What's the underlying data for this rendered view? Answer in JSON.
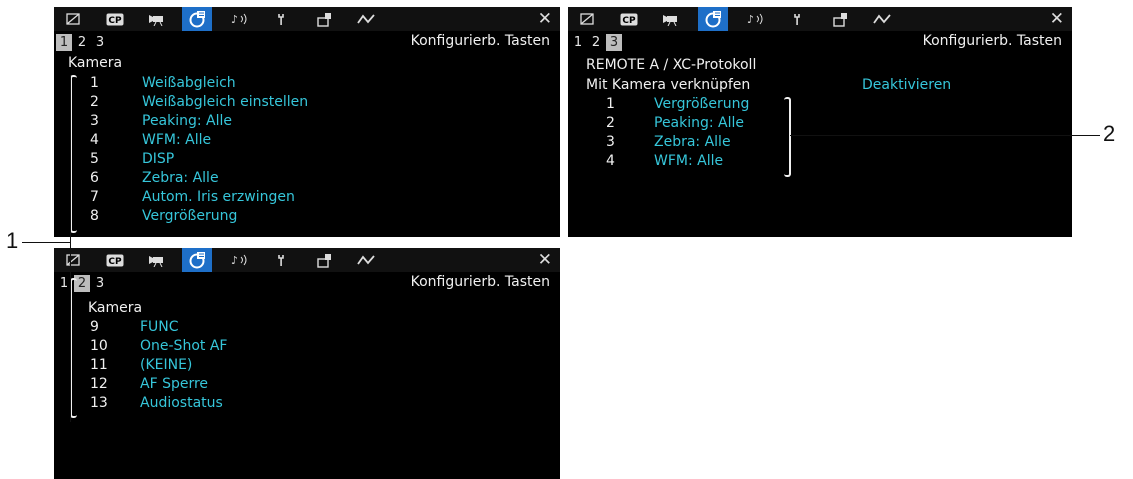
{
  "tabs": [
    {
      "icon": "picture-icon"
    },
    {
      "icon": "cp-icon",
      "label": "CP"
    },
    {
      "icon": "camera-icon"
    },
    {
      "icon": "custom-function-icon",
      "active": true
    },
    {
      "icon": "audio-icon"
    },
    {
      "icon": "wrench-icon"
    },
    {
      "icon": "assign-icon"
    },
    {
      "icon": "network-icon"
    }
  ],
  "close_label": "✕",
  "menu_title": "Konfigurierb. Tasten",
  "screen1": {
    "pages": [
      "1",
      "2",
      "3"
    ],
    "active_page": 0,
    "section": "Kamera",
    "items": [
      {
        "num": "1",
        "value": "Weißabgleich"
      },
      {
        "num": "2",
        "value": "Weißabgleich einstellen"
      },
      {
        "num": "3",
        "value": "Peaking: Alle"
      },
      {
        "num": "4",
        "value": "WFM: Alle"
      },
      {
        "num": "5",
        "value": "DISP"
      },
      {
        "num": "6",
        "value": "Zebra: Alle"
      },
      {
        "num": "7",
        "value": "Autom. Iris erzwingen"
      },
      {
        "num": "8",
        "value": "Vergrößerung"
      }
    ]
  },
  "screen2": {
    "pages": [
      "1",
      "2",
      "3"
    ],
    "active_page": 1,
    "section": "Kamera",
    "items": [
      {
        "num": "9",
        "value": "FUNC"
      },
      {
        "num": "10",
        "value": "One-Shot AF"
      },
      {
        "num": "11",
        "value": "(KEINE)"
      },
      {
        "num": "12",
        "value": "AF Sperre"
      },
      {
        "num": "13",
        "value": "Audiostatus"
      }
    ]
  },
  "screen3": {
    "pages": [
      "1",
      "2",
      "3"
    ],
    "active_page": 2,
    "section": "REMOTE A / XC-Protokoll",
    "link_label": "Mit Kamera verknüpfen",
    "link_value": "Deaktivieren",
    "items": [
      {
        "num": "1",
        "value": "Vergrößerung"
      },
      {
        "num": "2",
        "value": "Peaking: Alle"
      },
      {
        "num": "3",
        "value": "Zebra: Alle"
      },
      {
        "num": "4",
        "value": "WFM: Alle"
      }
    ]
  },
  "callouts": {
    "one": "1",
    "two": "2"
  },
  "colors": {
    "value": "#36c6da",
    "active_tab": "#1e6fc8",
    "screen_bg": "#000000"
  }
}
